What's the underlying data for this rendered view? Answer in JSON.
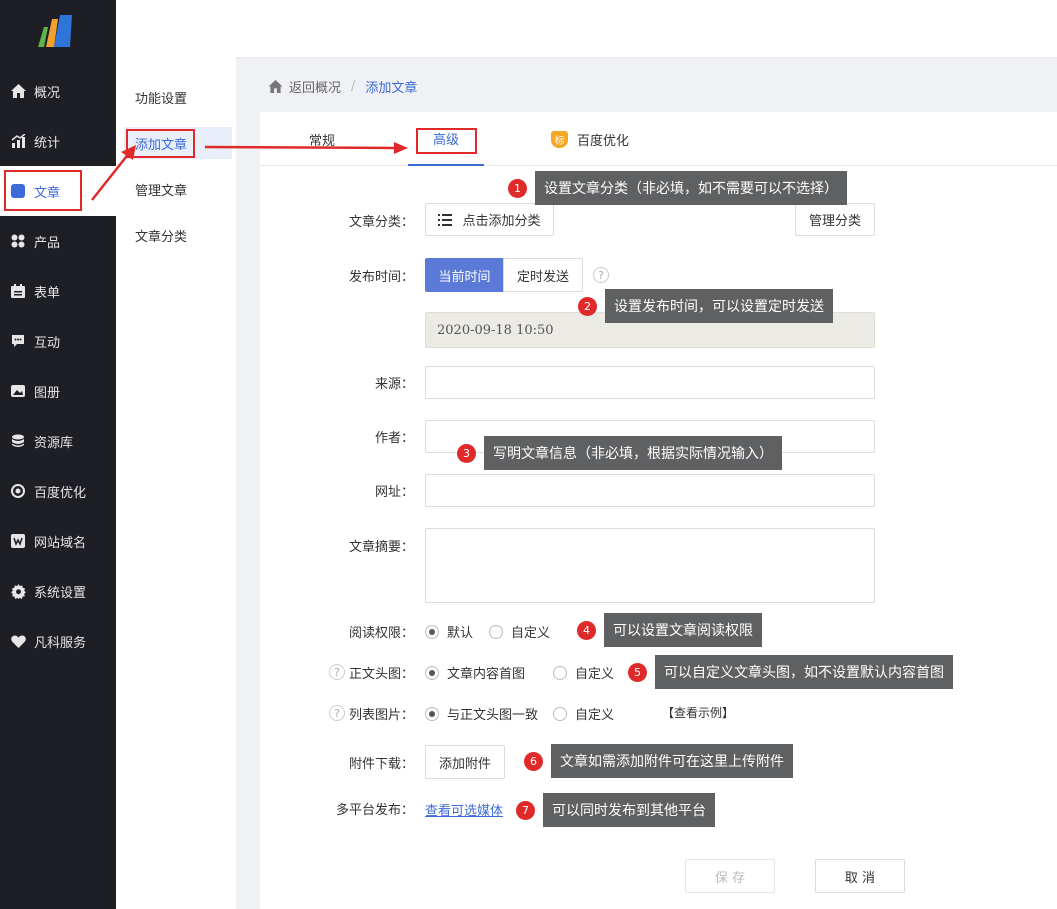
{
  "nav": {
    "items": [
      {
        "label": "概况",
        "icon": "home-icon"
      },
      {
        "label": "统计",
        "icon": "chart-icon"
      },
      {
        "label": "文章",
        "icon": "article-icon"
      },
      {
        "label": "产品",
        "icon": "grid-icon"
      },
      {
        "label": "表单",
        "icon": "calendar-icon"
      },
      {
        "label": "互动",
        "icon": "chat-icon"
      },
      {
        "label": "图册",
        "icon": "image-icon"
      },
      {
        "label": "资源库",
        "icon": "database-icon"
      },
      {
        "label": "百度优化",
        "icon": "target-icon"
      },
      {
        "label": "网站域名",
        "icon": "w-icon"
      },
      {
        "label": "系统设置",
        "icon": "gear-icon"
      },
      {
        "label": "凡科服务",
        "icon": "heart-icon"
      }
    ]
  },
  "subnav": {
    "items": [
      "功能设置",
      "添加文章",
      "管理文章",
      "文章分类"
    ]
  },
  "breadcrumb": {
    "back": "返回概况",
    "sep": "/",
    "current": "添加文章"
  },
  "tabs": {
    "normal": "常规",
    "advanced": "高级",
    "baidu": "百度优化",
    "baidu_badge": "标"
  },
  "form": {
    "category_label": "文章分类：",
    "add_category": "点击添加分类",
    "manage_category": "管理分类",
    "publish_label": "发布时间：",
    "now_btn": "当前时间",
    "timed_btn": "定时发送",
    "qmark": "?",
    "datetime": "2020-09-18 10:50",
    "source_label": "来源：",
    "author_label": "作者：",
    "url_label": "网址：",
    "summary_label": "文章摘要：",
    "read_label": "阅读权限：",
    "read_default": "默认",
    "read_custom": "自定义",
    "head_label": "正文头图：",
    "head_first": "文章内容首图",
    "head_custom": "自定义",
    "list_label": "列表图片：",
    "list_same": "与正文头图一致",
    "list_custom": "自定义",
    "list_example": "【查看示例】",
    "attach_label": "附件下载：",
    "attach_btn": "添加附件",
    "multi_label": "多平台发布：",
    "multi_link": "查看可选媒体",
    "save": "保 存",
    "cancel": "取 消"
  },
  "tips": [
    {
      "num": "1",
      "text": "设置文章分类（非必填，如不需要可以不选择）"
    },
    {
      "num": "2",
      "text": "设置发布时间，可以设置定时发送"
    },
    {
      "num": "3",
      "text": "写明文章信息（非必填，根据实际情况输入）"
    },
    {
      "num": "4",
      "text": "可以设置文章阅读权限"
    },
    {
      "num": "5",
      "text": "可以自定义文章头图，如不设置默认内容首图"
    },
    {
      "num": "6",
      "text": "文章如需添加附件可在这里上传附件"
    },
    {
      "num": "7",
      "text": "可以同时发布到其他平台"
    }
  ],
  "colors": {
    "accent": "#3d6bd8",
    "primary_btn": "#5b7ad8",
    "annotation": "#e02a2a",
    "tip_bg": "#5f6062"
  }
}
